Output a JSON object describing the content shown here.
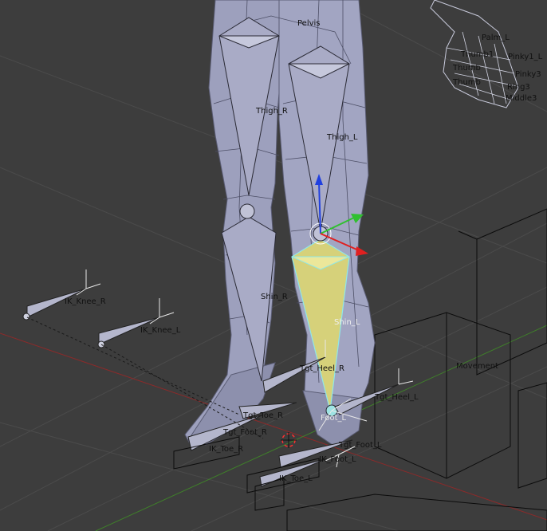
{
  "viewport": {
    "background": "#3d3d3d",
    "grid_color": "#4a4a4a",
    "axis_x_color": "#8b2a2a",
    "axis_y_color": "#3f7f2a",
    "mesh_color": "#9da0bd",
    "mesh_shade_color": "#7c7f9c",
    "selected_bone_color": "#d6d17a",
    "selected_outline_color": "#8fe8e8",
    "wire_box_color": "#0a0a0a"
  },
  "bones": {
    "pelvis": "Pelvis",
    "palm_l": "Palm_L",
    "thumb1": "Thumb1",
    "pinky1_l": "Pinky1_L",
    "thumb_cluster": "Thumb",
    "pinky_cluster": "Pinky3",
    "ring3": "Ring3",
    "middle3": "Middle3",
    "thigh_r": "Thigh_R",
    "thigh_l": "Thigh_L",
    "shin_r": "Shin_R",
    "shin_l": "Shin_L",
    "ik_knee_r": "IK_Knee_R",
    "ik_knee_l": "IK_Knee_L",
    "tgt_heel_r": "Tgt_Heel_R",
    "tgt_heel_l": "Tgt_Heel_L",
    "foot_l": "Foot_L",
    "tgt_toe_r": "Tgt_Toe_R",
    "tgt_foot_r": "Tgt_Foot_R",
    "ik_toe_r": "IK_Toe_R",
    "tgt_foot_l": "Tgt_Foot_L",
    "ik_foot_l": "IK_Foot_L",
    "ik_toe_l": "IK_Toe_L",
    "movement": "Movement"
  },
  "gizmo": {
    "x_color": "#e02020",
    "y_color": "#30c030",
    "z_color": "#2040e0",
    "pivot_color": "#ffffff"
  }
}
